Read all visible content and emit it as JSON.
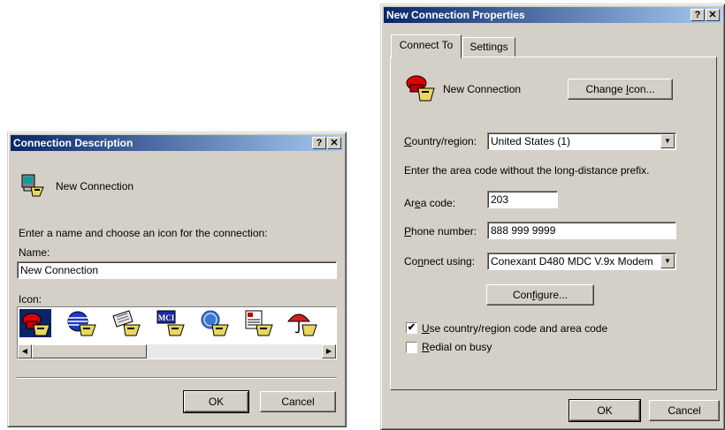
{
  "left_dialog": {
    "title": "Connection Description",
    "help_btn": "?",
    "close_btn": "✕",
    "connection_name": "New Connection",
    "prompt": "Enter a name and choose an icon for the connection:",
    "name_label": "Name:",
    "name_value": "New Connection",
    "icon_label": "Icon:",
    "icons": [
      "phone-icon",
      "globe-icon",
      "fax-icon",
      "mci-icon",
      "ge-icon",
      "document-icon",
      "umbrella-icon"
    ],
    "mci_text": "MCI",
    "ok": "OK",
    "cancel": "Cancel"
  },
  "right_dialog": {
    "title": "New Connection Properties",
    "help_btn": "?",
    "close_btn": "✕",
    "tabs": [
      "Connect To",
      "Settings"
    ],
    "connection_name": "New Connection",
    "change_icon_pre": "Change ",
    "change_icon_u": "I",
    "change_icon_post": "con...",
    "country_label_u": "C",
    "country_label_rest": "ountry/region:",
    "country_value": "United States (1)",
    "area_hint": "Enter the area code without the long-distance prefix.",
    "area_label_pre": "Ar",
    "area_label_u": "e",
    "area_label_post": "a code:",
    "area_value": "203",
    "phone_label_u": "P",
    "phone_label_rest": "hone number:",
    "phone_value": "888 999 9999",
    "connect_label_pre": "Co",
    "connect_label_u": "n",
    "connect_label_post": "nect using:",
    "connect_value": "Conexant D480 MDC V.9x Modem",
    "configure_pre": "Con",
    "configure_u": "f",
    "configure_post": "igure...",
    "use_country_u": "U",
    "use_country_rest": "se country/region code and area code",
    "use_country_checked": "✔",
    "redial_u": "R",
    "redial_rest": "edial on busy",
    "ok": "OK",
    "cancel": "Cancel"
  },
  "colors": {
    "titlebar_start": "#0a246a",
    "titlebar_end": "#a6caf0",
    "face": "#d4d0c8"
  }
}
